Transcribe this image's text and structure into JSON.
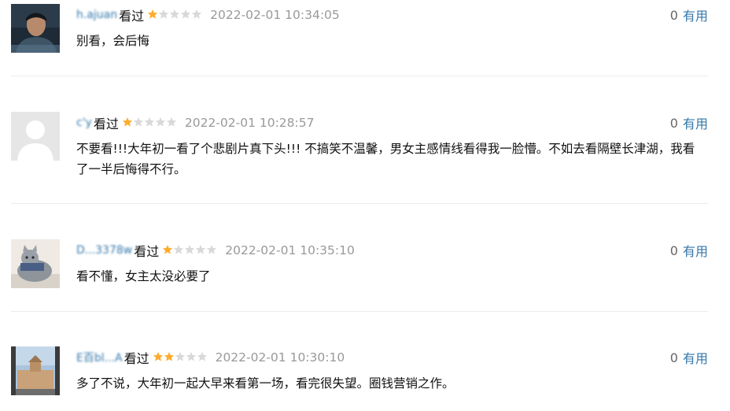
{
  "reviews": [
    {
      "username": "h.ajuan",
      "status": "看过",
      "rating": 1,
      "date": "2022-02-01 10:34:05",
      "votes": "0",
      "vote_label": "有用",
      "content": "别看，会后悔",
      "avatar_icon": "man-portrait-avatar"
    },
    {
      "username": "c'y",
      "status": "看过",
      "rating": 1,
      "date": "2022-02-01 10:28:57",
      "votes": "0",
      "vote_label": "有用",
      "content": "不要看!!!大年初一看了个悲剧片真下头!!! 不搞笑不温馨，男女主感情线看得我一脸懵。不如去看隔壁长津湖，我看了一半后悔得不行。",
      "avatar_icon": "default-person-avatar"
    },
    {
      "username": "D...3378w",
      "status": "看过",
      "rating": 1,
      "date": "2022-02-01 10:35:10",
      "votes": "0",
      "vote_label": "有用",
      "content": "看不懂，女主太没必要了",
      "avatar_icon": "cat-avatar"
    },
    {
      "username": "E百bl...A",
      "status": "看过",
      "rating": 2,
      "date": "2022-02-01 10:30:10",
      "votes": "0",
      "vote_label": "有用",
      "content": "多了不说，大年初一起大早来看第一场，看完很失望。圈钱营销之作。",
      "avatar_icon": "building-avatar"
    }
  ],
  "colors": {
    "star_filled": "#ffac2d",
    "star_empty": "#d9d9d9",
    "link": "#3377aa",
    "date": "#999999"
  }
}
